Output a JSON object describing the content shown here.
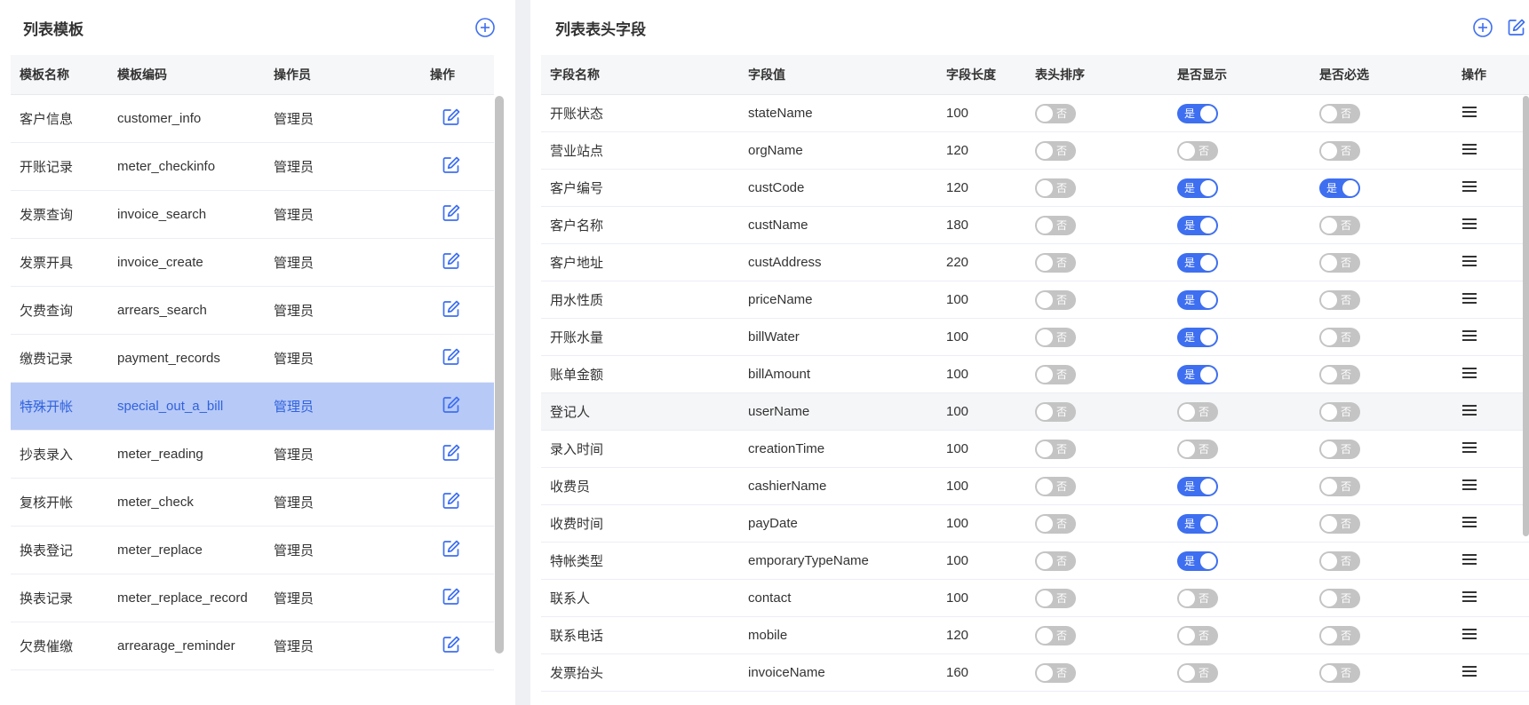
{
  "left": {
    "title": "列表模板",
    "headers": [
      "模板名称",
      "模板编码",
      "操作员",
      "操作"
    ],
    "rows": [
      {
        "name": "客户信息",
        "code": "customer_info",
        "operator": "管理员",
        "selected": false
      },
      {
        "name": "开账记录",
        "code": "meter_checkinfo",
        "operator": "管理员",
        "selected": false
      },
      {
        "name": "发票查询",
        "code": "invoice_search",
        "operator": "管理员",
        "selected": false
      },
      {
        "name": "发票开具",
        "code": "invoice_create",
        "operator": "管理员",
        "selected": false
      },
      {
        "name": "欠费查询",
        "code": "arrears_search",
        "operator": "管理员",
        "selected": false
      },
      {
        "name": "缴费记录",
        "code": "payment_records",
        "operator": "管理员",
        "selected": false
      },
      {
        "name": "特殊开帐",
        "code": "special_out_a_bill",
        "operator": "管理员",
        "selected": true
      },
      {
        "name": "抄表录入",
        "code": "meter_reading",
        "operator": "管理员",
        "selected": false
      },
      {
        "name": "复核开帐",
        "code": "meter_check",
        "operator": "管理员",
        "selected": false
      },
      {
        "name": "换表登记",
        "code": "meter_replace",
        "operator": "管理员",
        "selected": false
      },
      {
        "name": "换表记录",
        "code": "meter_replace_record",
        "operator": "管理员",
        "selected": false
      },
      {
        "name": "欠费催缴",
        "code": "arrearage_reminder",
        "operator": "管理员",
        "selected": false
      }
    ],
    "icons": {
      "add": "plus-circle-icon",
      "edit": "edit-icon"
    }
  },
  "right": {
    "title": "列表表头字段",
    "headers": [
      "字段名称",
      "字段值",
      "字段长度",
      "表头排序",
      "是否显示",
      "是否必选",
      "操作"
    ],
    "toggle_on_label": "是",
    "toggle_off_label": "否",
    "rows": [
      {
        "name": "开账状态",
        "value": "stateName",
        "length": "100",
        "sort": false,
        "show": true,
        "required": false
      },
      {
        "name": "营业站点",
        "value": "orgName",
        "length": "120",
        "sort": false,
        "show": false,
        "required": false
      },
      {
        "name": "客户编号",
        "value": "custCode",
        "length": "120",
        "sort": false,
        "show": true,
        "required": true
      },
      {
        "name": "客户名称",
        "value": "custName",
        "length": "180",
        "sort": false,
        "show": true,
        "required": false
      },
      {
        "name": "客户地址",
        "value": "custAddress",
        "length": "220",
        "sort": false,
        "show": true,
        "required": false
      },
      {
        "name": "用水性质",
        "value": "priceName",
        "length": "100",
        "sort": false,
        "show": true,
        "required": false
      },
      {
        "name": "开账水量",
        "value": "billWater",
        "length": "100",
        "sort": false,
        "show": true,
        "required": false
      },
      {
        "name": "账单金额",
        "value": "billAmount",
        "length": "100",
        "sort": false,
        "show": true,
        "required": false
      },
      {
        "name": "登记人",
        "value": "userName",
        "length": "100",
        "sort": false,
        "show": false,
        "required": false,
        "hover": true
      },
      {
        "name": "录入时间",
        "value": "creationTime",
        "length": "100",
        "sort": false,
        "show": false,
        "required": false
      },
      {
        "name": "收费员",
        "value": "cashierName",
        "length": "100",
        "sort": false,
        "show": true,
        "required": false
      },
      {
        "name": "收费时间",
        "value": "payDate",
        "length": "100",
        "sort": false,
        "show": true,
        "required": false
      },
      {
        "name": "特帐类型",
        "value": "emporaryTypeName",
        "length": "100",
        "sort": false,
        "show": true,
        "required": false
      },
      {
        "name": "联系人",
        "value": "contact",
        "length": "100",
        "sort": false,
        "show": false,
        "required": false
      },
      {
        "name": "联系电话",
        "value": "mobile",
        "length": "120",
        "sort": false,
        "show": false,
        "required": false
      },
      {
        "name": "发票抬头",
        "value": "invoiceName",
        "length": "160",
        "sort": false,
        "show": false,
        "required": false
      }
    ],
    "icons": {
      "add": "plus-circle-icon",
      "edit": "edit-icon",
      "drag": "menu-icon"
    }
  },
  "colors": {
    "accent": "#3e6ff0",
    "selected_row": "#b7c9f6",
    "toggle_off": "#c4c4c4"
  }
}
